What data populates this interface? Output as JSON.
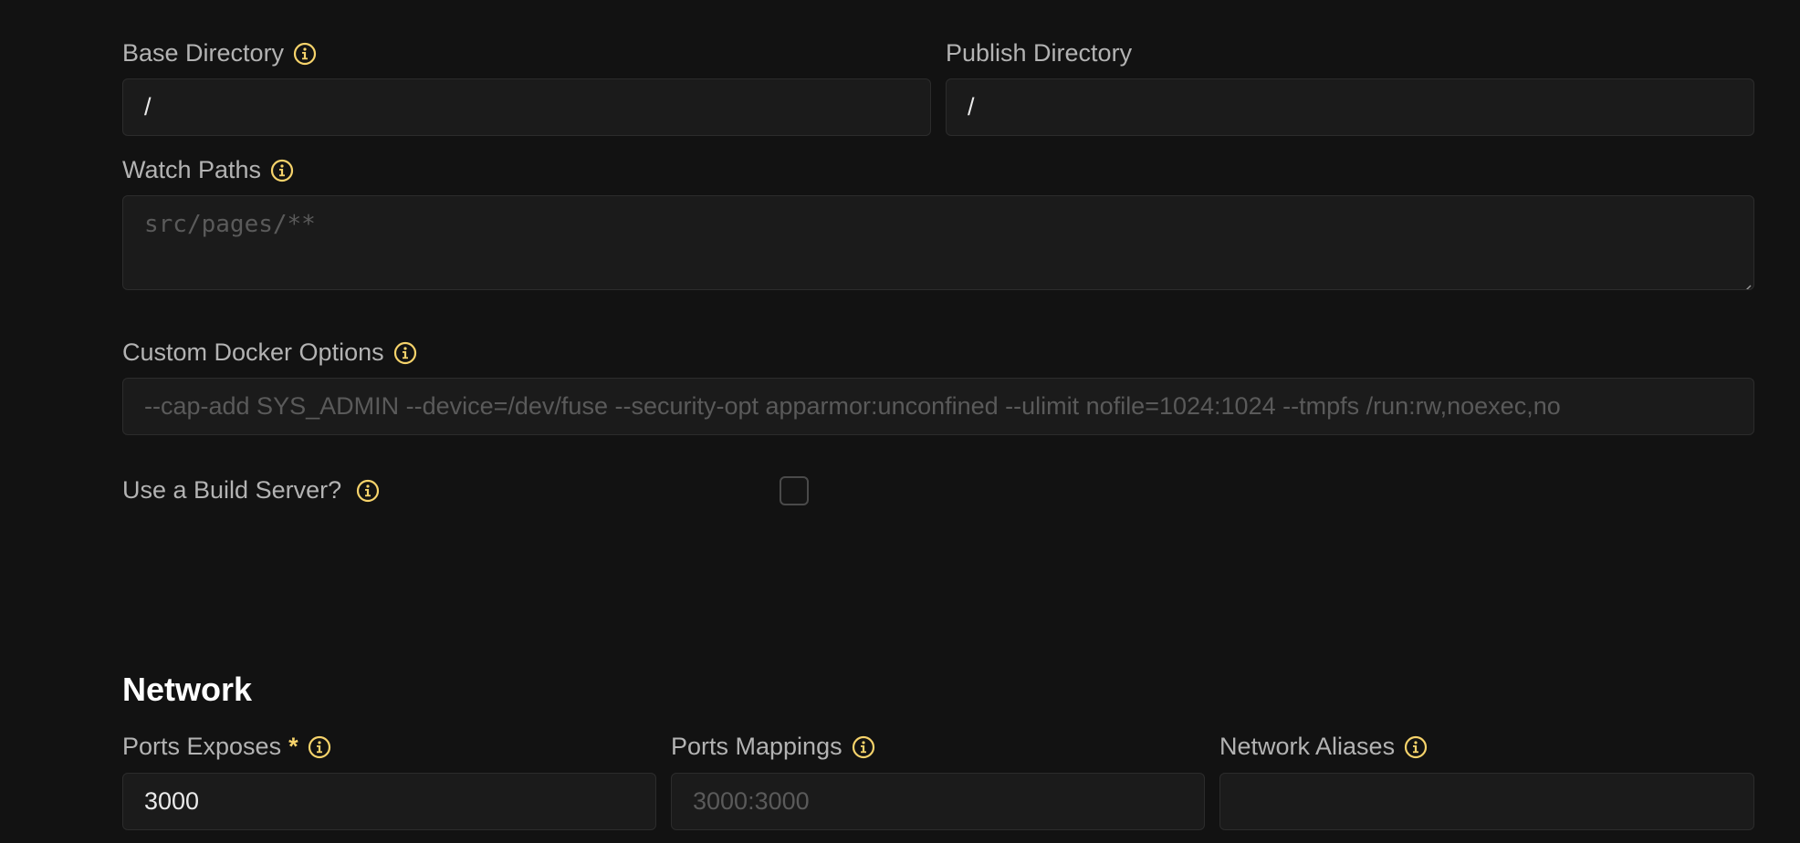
{
  "build": {
    "base_directory": {
      "label": "Base Directory",
      "value": "/"
    },
    "publish_directory": {
      "label": "Publish Directory",
      "value": "/"
    },
    "watch_paths": {
      "label": "Watch Paths",
      "placeholder": "src/pages/**"
    },
    "custom_docker_options": {
      "label": "Custom Docker Options",
      "placeholder": "--cap-add SYS_ADMIN --device=/dev/fuse --security-opt apparmor:unconfined --ulimit nofile=1024:1024 --tmpfs /run:rw,noexec,no"
    },
    "build_server": {
      "label": "Use a Build Server?",
      "checked": false
    }
  },
  "network": {
    "title": "Network",
    "ports_exposes": {
      "label": "Ports Exposes",
      "required_mark": "*",
      "value": "3000"
    },
    "ports_mappings": {
      "label": "Ports Mappings",
      "placeholder": "3000:3000"
    },
    "network_aliases": {
      "label": "Network Aliases",
      "value": ""
    }
  },
  "icons": {
    "info": "info-circle-icon"
  },
  "colors": {
    "background": "#121212",
    "input_background": "#1b1b1b",
    "input_border": "#2c2c2c",
    "accent": "#f6d36b",
    "label": "#b3b3b3",
    "placeholder": "#5a5a5a"
  }
}
